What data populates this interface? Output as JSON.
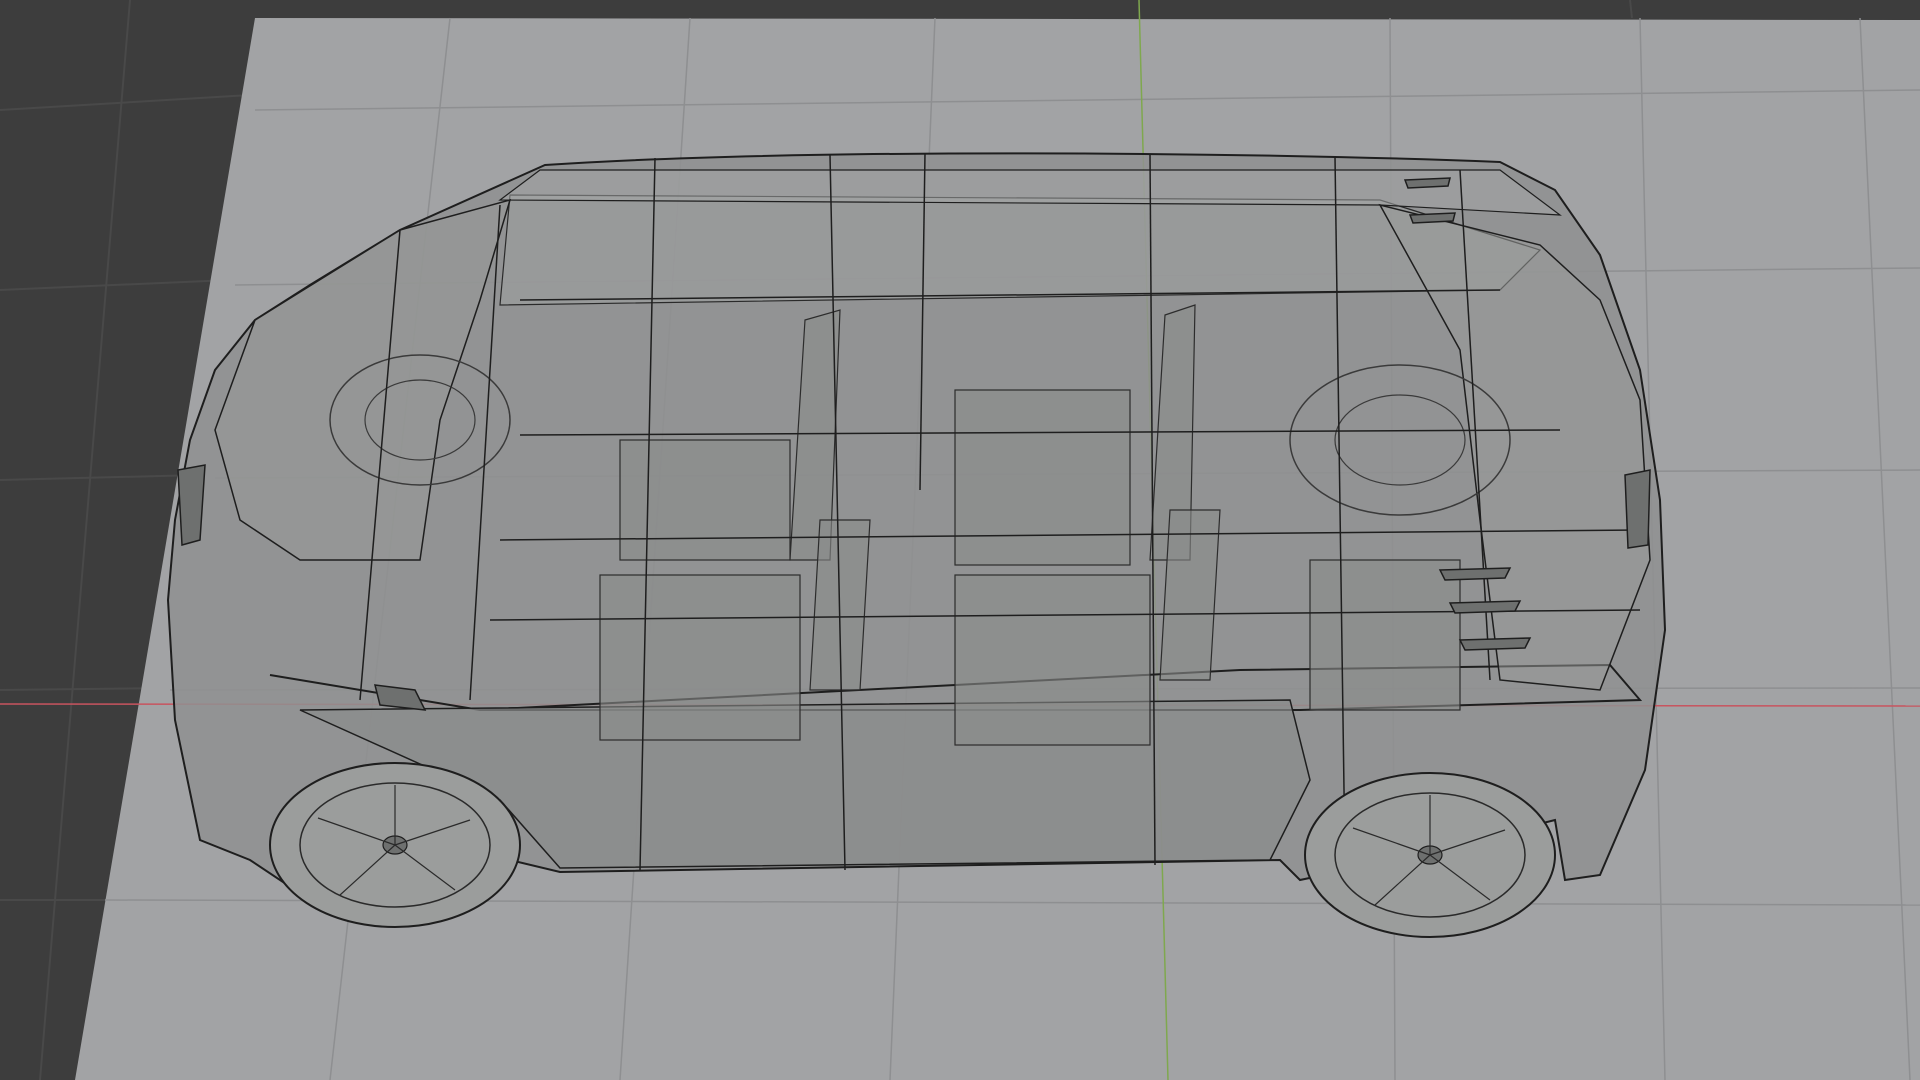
{
  "app": {
    "view": "3d-viewport",
    "shading_mode": "wireframe-xray"
  },
  "scene": {
    "background_color": "#3d3d3d",
    "ground_plane_color": "#a2a3a5",
    "grid_color": "#8e8f91",
    "outer_grid_color": "#494949",
    "x_axis_color": "#c8545f",
    "y_axis_color": "#7fa84e",
    "wire_color": "#1e1e1e",
    "body_fill_color": "#8f9190",
    "object": {
      "name_visible": false,
      "description_icon": "van-wireframe-icon"
    }
  }
}
